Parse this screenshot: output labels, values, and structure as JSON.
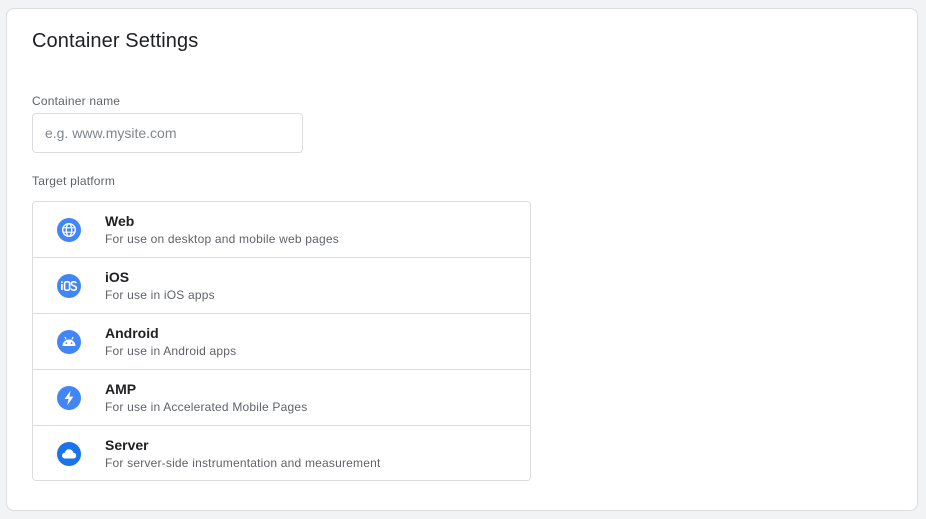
{
  "page": {
    "title": "Container Settings"
  },
  "container_name": {
    "label": "Container name",
    "value": "",
    "placeholder": "e.g. www.mysite.com"
  },
  "target_platform": {
    "label": "Target platform",
    "items": [
      {
        "name": "Web",
        "description": "For use on desktop and mobile web pages",
        "icon": "globe-icon"
      },
      {
        "name": "iOS",
        "description": "For use in iOS apps",
        "icon": "ios-icon"
      },
      {
        "name": "Android",
        "description": "For use in Android apps",
        "icon": "android-icon"
      },
      {
        "name": "AMP",
        "description": "For use in Accelerated Mobile Pages",
        "icon": "lightning-bolt-icon"
      },
      {
        "name": "Server",
        "description": "For server-side instrumentation and measurement",
        "icon": "cloud-icon"
      }
    ]
  },
  "colors": {
    "accent": "#4285f4",
    "server_accent": "#1a73e8",
    "border": "#dadce0",
    "text_primary": "#202124",
    "text_secondary": "#5f6368"
  }
}
